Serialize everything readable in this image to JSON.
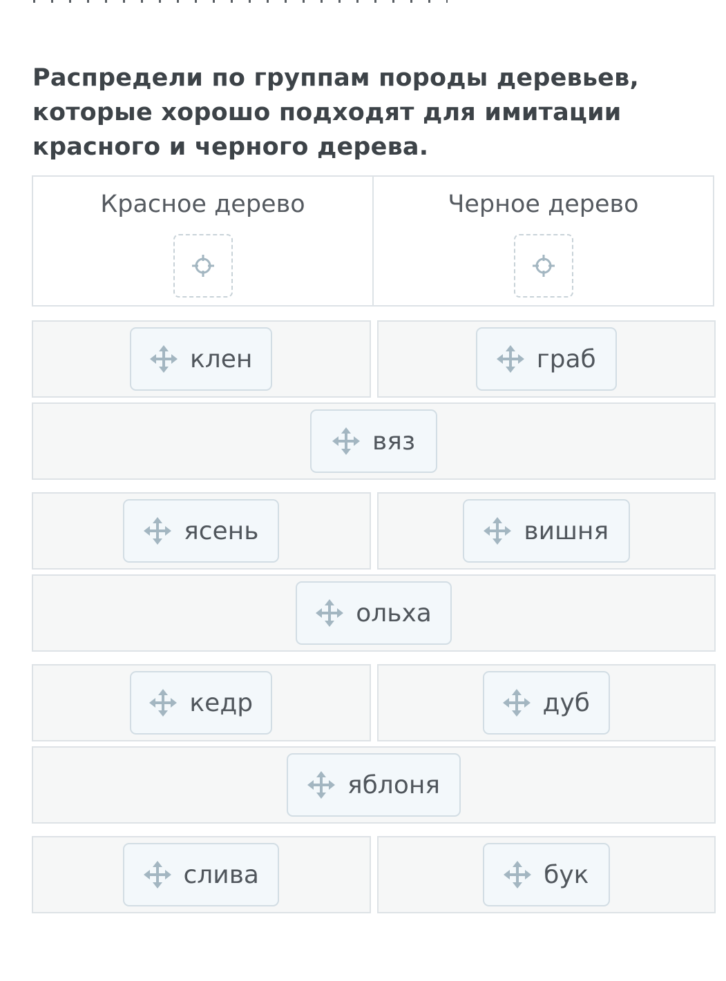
{
  "question": {
    "text": "Распредели по группам породы деревьев, которые хорошо подходят для имитации красного и черного дерева."
  },
  "groups": [
    {
      "title": "Красное дерево",
      "icon": "crosshair-icon"
    },
    {
      "title": "Черное дерево",
      "icon": "crosshair-icon"
    }
  ],
  "cards": [
    {
      "label": "клен",
      "icon": "move-icon"
    },
    {
      "label": "граб",
      "icon": "move-icon"
    },
    {
      "label": "вяз",
      "icon": "move-icon"
    },
    {
      "label": "ясень",
      "icon": "move-icon"
    },
    {
      "label": "вишня",
      "icon": "move-icon"
    },
    {
      "label": "ольха",
      "icon": "move-icon"
    },
    {
      "label": "кедр",
      "icon": "move-icon"
    },
    {
      "label": "дуб",
      "icon": "move-icon"
    },
    {
      "label": "яблоня",
      "icon": "move-icon"
    },
    {
      "label": "слива",
      "icon": "move-icon"
    },
    {
      "label": "бук",
      "icon": "move-icon"
    }
  ],
  "colors": {
    "card_bg": "#f3f8fb",
    "card_border": "#d2dde4",
    "cell_bg": "#f6f7f7",
    "icon": "#a3b6c1"
  }
}
